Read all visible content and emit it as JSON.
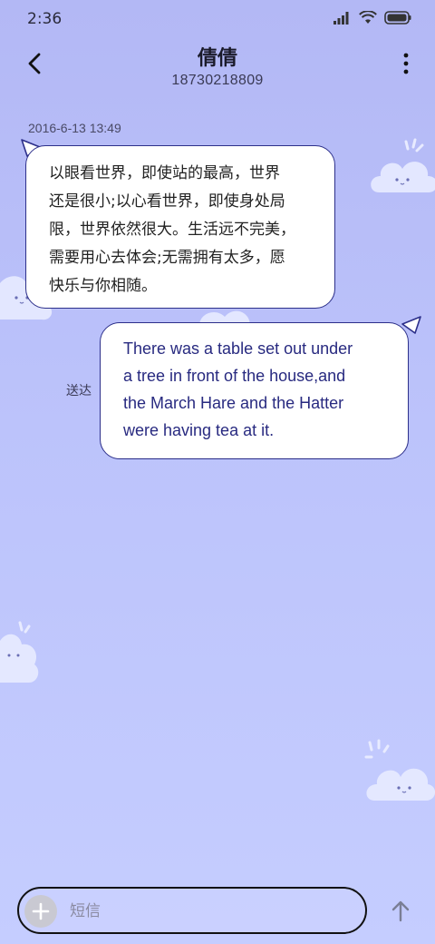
{
  "status_bar": {
    "time": "2:36",
    "icons": [
      "signal-icon",
      "wifi-icon",
      "battery-icon"
    ]
  },
  "header": {
    "contact_name": "倩倩",
    "contact_phone": "18730218809",
    "back_icon": "back-arrow-icon",
    "menu_icon": "more-vertical-icon"
  },
  "conversation": {
    "timestamp": "2016-6-13 13:49",
    "messages": [
      {
        "direction": "incoming",
        "lines": [
          "以眼看世界，即使站的最高，世界",
          "还是很小;以心看世界，即使身处局",
          "限，世界依然很大。生活远不完美，",
          "需要用心去体会;无需拥有太多，愿",
          "快乐与你相随。"
        ]
      },
      {
        "direction": "outgoing",
        "status": "送达",
        "lines": [
          "There was a table set out under",
          "a tree in front of the house,and",
          "the March Hare and the Hatter",
          "were having tea at it."
        ]
      }
    ]
  },
  "composer": {
    "placeholder": "短信",
    "value": "",
    "add_icon": "plus-icon",
    "send_icon": "send-arrow-icon"
  },
  "colors": {
    "background_top": "#b3b8f5",
    "background_bottom": "#c5cdff",
    "bubble_border": "#2c2f8a",
    "bubble_fill": "#ffffff"
  }
}
